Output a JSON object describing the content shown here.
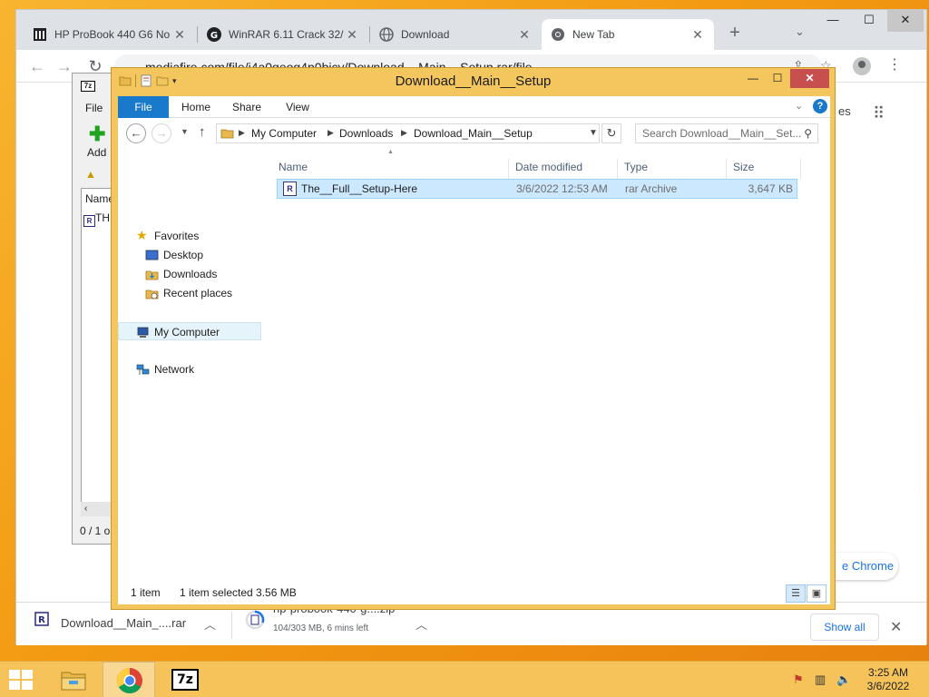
{
  "chrome": {
    "tabs": [
      {
        "title": "HP ProBook 440 G6 No",
        "favicon": "building-icon"
      },
      {
        "title": "WinRAR 6.11 Crack 32/",
        "favicon": "g-circle-icon"
      },
      {
        "title": "Download",
        "favicon": "globe-icon"
      },
      {
        "title": "New Tab",
        "favicon": "chrome-icon"
      }
    ],
    "active_tab": 3,
    "url": "mediafire.com/file/i4a0geog4p0bicv/Download__Main__Setup.rar/file",
    "page_partial_text": "es",
    "page_pill_text": "e Chrome",
    "downloads": [
      {
        "name": "Download__Main_....rar",
        "status": ""
      },
      {
        "name": "hp-probook-440-g....zip",
        "status": "104/303 MB, 6 mins left"
      }
    ],
    "show_all_label": "Show all"
  },
  "sevenzip": {
    "icon_label": "7z",
    "menu_file": "File",
    "add_label": "Add",
    "column_name": "Name",
    "row_name": "TH",
    "status": "0 / 1 o"
  },
  "explorer": {
    "title": "Download__Main__Setup",
    "ribbon_tabs": [
      "File",
      "Home",
      "Share",
      "View"
    ],
    "breadcrumbs": [
      "My Computer",
      "Downloads",
      "Download_Main__Setup"
    ],
    "search_placeholder": "Search Download__Main__Set...",
    "nav": {
      "favorites": "Favorites",
      "desktop": "Desktop",
      "downloads": "Downloads",
      "recent_places": "Recent places",
      "my_computer": "My Computer",
      "network": "Network"
    },
    "columns": [
      "Name",
      "Date modified",
      "Type",
      "Size"
    ],
    "files": [
      {
        "name": "The__Full__Setup-Here",
        "date": "3/6/2022 12:53 AM",
        "type": "rar Archive",
        "size": "3,647 KB",
        "icon": "rar-archive-icon"
      }
    ],
    "status_count": "1 item",
    "status_selected": "1 item selected  3.56 MB"
  },
  "taskbar": {
    "apps": [
      "file-explorer-icon",
      "chrome-icon",
      "7zip-icon"
    ],
    "sevenzip_label": "7z",
    "time": "3:25 AM",
    "date": "3/6/2022"
  },
  "colors": {
    "accent_blue": "#1979ca",
    "explorer_frame": "#f4c75e",
    "taskbar": "#f5c35a",
    "close_red": "#c7504f",
    "selection": "#cce8ff"
  }
}
